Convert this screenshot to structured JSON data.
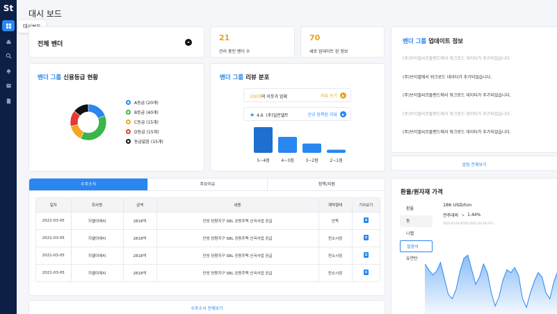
{
  "sidebar": {
    "logo": "St",
    "items": [
      {
        "icon": "dashboard-icon",
        "active": true
      },
      {
        "icon": "ship-icon"
      },
      {
        "icon": "search-icon"
      },
      {
        "icon": "bell-icon"
      },
      {
        "icon": "box-icon"
      },
      {
        "icon": "document-icon"
      }
    ],
    "tooltip": "대시보드"
  },
  "page": {
    "title": "대시 보드"
  },
  "vendor_select": {
    "label": "전체 벤더"
  },
  "stats": [
    {
      "value": "21",
      "label": "관리 중인 벤더 수"
    },
    {
      "value": "70",
      "label": "새로 업데이트 된 정보"
    }
  ],
  "updates": {
    "title_accent": "벤더 그룹",
    "title": "업데이트 정보",
    "items": [
      {
        "text": "(주)브이엘씨코몰랜드에서 워크로드 데이터가 추가되었습니다.",
        "faded": true
      },
      {
        "text": "(주)브이엘에서 워크로드 데이터가 추가되었습니다.",
        "faded": false
      },
      {
        "text": "(주)브이엘씨코몰랜드에서 워크로드 데이터가 추가되었습니다.",
        "faded": false
      },
      {
        "text": "(주)브이엘씨코몰랜드에서 워크로드 데이터가 추가되었습니다.",
        "faded": true
      },
      {
        "text": "(주)브이엘씨코몰랜드에서 워크로드 데이터가 추가되었습니다.",
        "faded": false
      }
    ],
    "more": "알림 전체보기"
  },
  "credit": {
    "title_accent": "벤더 그룹",
    "title": "신용등급 현황",
    "legend": [
      {
        "label": "A등급 (20개)",
        "color": "#2a86f0"
      },
      {
        "label": "B등급 (40개)",
        "color": "#3ab54a"
      },
      {
        "label": "C등급 (15개)",
        "color": "#f5a623"
      },
      {
        "label": "D등급 (15개)",
        "color": "#e53935"
      },
      {
        "label": "등급없음 (15개)",
        "color": "#111111"
      }
    ]
  },
  "review": {
    "title_accent": "벤더 그룹",
    "title": "리뷰 분포",
    "top_count": "100개",
    "top_text": "의 이웃가 업체",
    "top_link": "리뷰 쓰기",
    "rating": "4.6",
    "company": "(주)일린델트",
    "bottom_link": "신규 등록된 리뷰"
  },
  "orders": {
    "tabs": [
      "수주소식",
      "주요이슈",
      "정책/지원"
    ],
    "columns": [
      "일자",
      "회사명",
      "금액",
      "내용",
      "계약형태",
      "기사보기"
    ],
    "rows": [
      [
        "2021-03-05",
        "지엘이에씨",
        "2818억",
        "안성 당왕지구 SBL 공동주택 신국사업 공급",
        "단독"
      ],
      [
        "2021-03-05",
        "지엘이에씨",
        "2818억",
        "안성 당왕지구 SBL 공동주택 신국사업 공급",
        "컨소시엄"
      ],
      [
        "2021-03-05",
        "지엘이에씨",
        "2818억",
        "안성 당왕지구 SBL 공동주택 신국사업 공급",
        "컨소시엄"
      ],
      [
        "2021-03-05",
        "지엘이에씨",
        "2818억",
        "안성 당왕지구 SBL 공동주택 신국사업 공급",
        "컨소시엄"
      ]
    ],
    "more": "수주소식 전체보기"
  },
  "price": {
    "title": "환율/원자재 가격",
    "menu": [
      {
        "label": "환율",
        "state": ""
      },
      {
        "label": "동",
        "state": "sel"
      },
      {
        "label": "니켈",
        "state": ""
      },
      {
        "label": "철광석",
        "state": "act"
      },
      {
        "label": "유연탄",
        "state": ""
      }
    ],
    "value": "186  USD/ton",
    "change_label": "전주대비",
    "change": "1.44%",
    "date": "2021-03-29 00:00 (2021-03-29 UTC)"
  },
  "chart_data": [
    {
      "type": "pie",
      "categories": [
        "A등급",
        "B등급",
        "C등급",
        "D등급",
        "등급없음"
      ],
      "values": [
        20,
        40,
        15,
        15,
        15
      ]
    },
    {
      "type": "bar",
      "categories": [
        "5~4점",
        "4~3점",
        "3~2점",
        "2~1점"
      ],
      "values": [
        100,
        62,
        36,
        12
      ]
    },
    {
      "type": "area",
      "values": [
        0.7,
        0.62,
        0.55,
        0.6,
        0.72,
        0.5,
        0.28,
        0.22,
        0.35,
        0.6,
        0.78,
        0.82,
        0.62,
        0.42,
        0.52,
        0.7,
        0.58,
        0.3,
        0.12,
        0.25,
        0.48,
        0.62,
        0.58,
        0.65,
        0.54,
        0.22,
        0.1,
        0.3,
        0.46,
        0.58,
        0.52,
        0.3,
        0.22,
        0.45,
        0.6
      ]
    }
  ],
  "colors": {
    "accent": "#2a86f0",
    "stat": "#e8a419",
    "sidebar": "#0c1f44"
  }
}
